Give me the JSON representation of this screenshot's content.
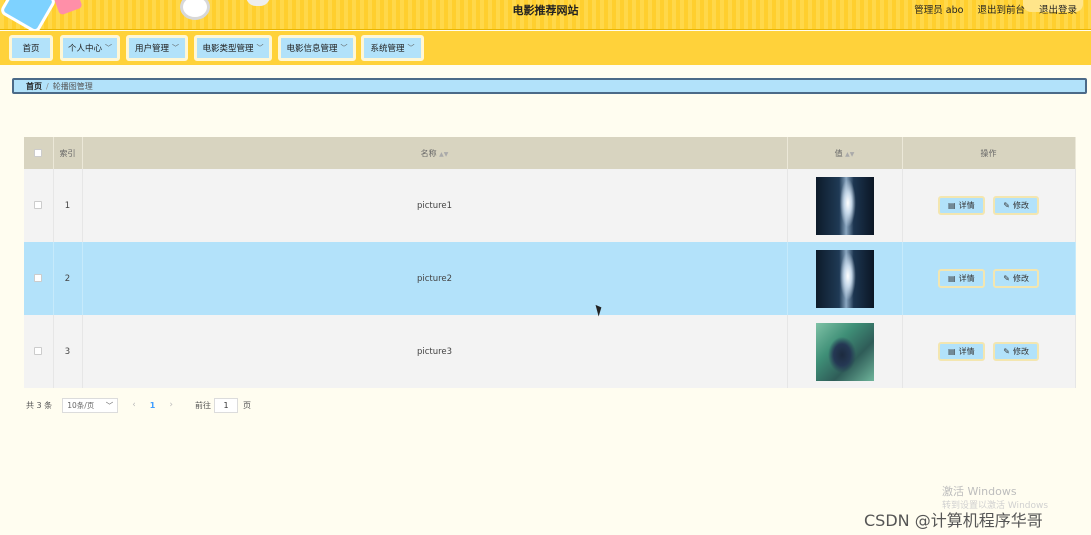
{
  "header": {
    "site_title": "电影推荐网站",
    "admin_label": "管理员 abo",
    "back_to_front": "退出到前台",
    "logout": "退出登录"
  },
  "nav": {
    "items": [
      {
        "label": "首页"
      },
      {
        "label": "个人中心"
      },
      {
        "label": "用户管理"
      },
      {
        "label": "电影类型管理"
      },
      {
        "label": "电影信息管理"
      },
      {
        "label": "系统管理"
      }
    ]
  },
  "breadcrumb": {
    "home": "首页",
    "separator": "/",
    "current": "轮播图管理"
  },
  "table": {
    "headers": {
      "index": "索引",
      "name": "名称",
      "value": "值",
      "actions": "操作"
    },
    "rows": [
      {
        "index": "1",
        "name": "picture1",
        "image": "dark-portrait"
      },
      {
        "index": "2",
        "name": "picture2",
        "image": "dark-portrait"
      },
      {
        "index": "3",
        "name": "picture3",
        "image": "green-scene"
      }
    ],
    "detail_label": "详情",
    "edit_label": "修改"
  },
  "pagination": {
    "total": "共 3 条",
    "page_size": "10条/页",
    "current_page": "1",
    "goto_label": "前往",
    "goto_value": "1",
    "unit": "页"
  },
  "watermarks": {
    "windows_line1": "激活 Windows",
    "windows_line2": "转到设置以激活 Windows",
    "csdn": "CSDN @计算机程序华哥"
  },
  "colors": {
    "header_yellow": "#ffd23a",
    "accent_blue": "#b2e2fa",
    "page_bg": "#fffdf0",
    "table_head": "#d8d4c0"
  }
}
